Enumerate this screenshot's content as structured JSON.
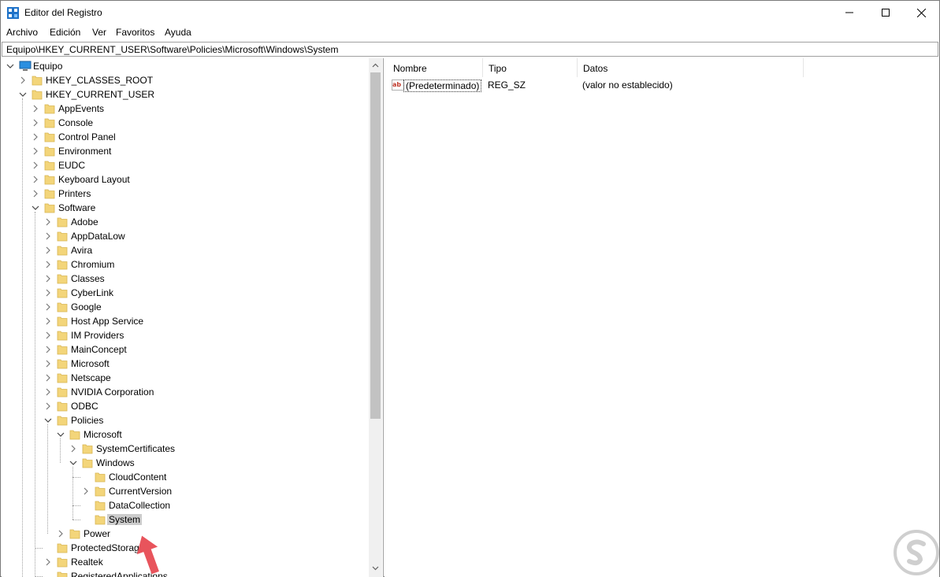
{
  "window": {
    "title": "Editor del Registro"
  },
  "menu": [
    "Archivo",
    "Edición",
    "Ver",
    "Favoritos",
    "Ayuda"
  ],
  "address": "Equipo\\HKEY_CURRENT_USER\\Software\\Policies\\Microsoft\\Windows\\System",
  "tree": {
    "root": "Equipo",
    "hkcr": "HKEY_CLASSES_ROOT",
    "hkcu": "HKEY_CURRENT_USER",
    "hkcu_children": [
      "AppEvents",
      "Console",
      "Control Panel",
      "Environment",
      "EUDC",
      "Keyboard Layout",
      "Printers",
      "Software"
    ],
    "software_children": [
      "Adobe",
      "AppDataLow",
      "Avira",
      "Chromium",
      "Classes",
      "CyberLink",
      "Google",
      "Host App Service",
      "IM Providers",
      "MainConcept",
      "Microsoft",
      "Netscape",
      "NVIDIA Corporation",
      "ODBC",
      "Policies"
    ],
    "policies_children": [
      "Microsoft"
    ],
    "policies_microsoft_children": [
      "SystemCertificates",
      "Windows"
    ],
    "windows_children": [
      "CloudContent",
      "CurrentVersion",
      "DataCollection",
      "System"
    ],
    "after_microsoft": [
      "Power"
    ],
    "after_policies": [
      "ProtectedStorage",
      "Realtek",
      "RegisteredApplications"
    ]
  },
  "list": {
    "columns": [
      "Nombre",
      "Tipo",
      "Datos"
    ],
    "rows": [
      {
        "name": "(Predeterminado)",
        "type": "REG_SZ",
        "data": "(valor no establecido)"
      }
    ]
  },
  "colors": {
    "folder": "#f3d57a",
    "selection": "#cccccc",
    "arrow": "#e8545c"
  },
  "icons": {
    "app": "registry-editor-icon",
    "computer": "computer-icon",
    "folder": "folder-icon",
    "string_value": "string-value-icon"
  }
}
